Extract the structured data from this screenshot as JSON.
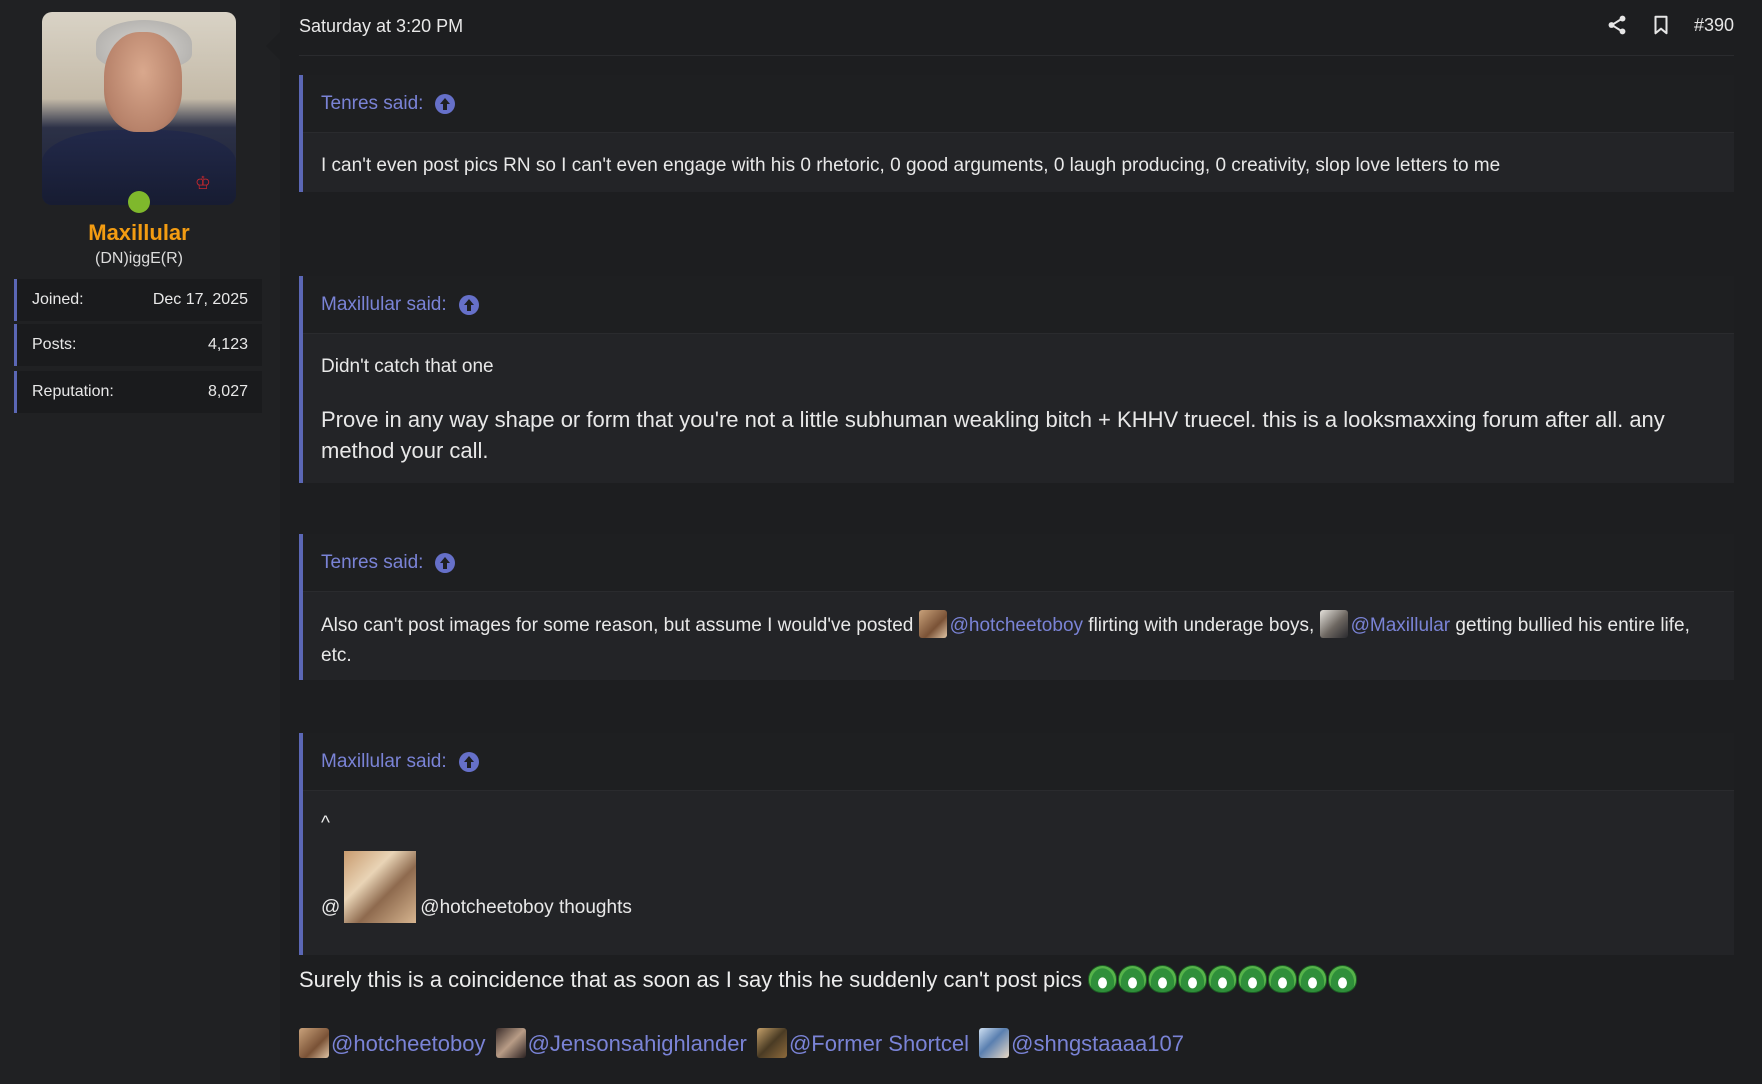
{
  "user": {
    "name": "Maxillular",
    "title": "(DN)iggE(R)",
    "stats": [
      {
        "label": "Joined:",
        "value": "Dec 17, 2025"
      },
      {
        "label": "Posts:",
        "value": "4,123"
      },
      {
        "label": "Reputation:",
        "value": "8,027"
      }
    ],
    "online": true
  },
  "post": {
    "date": "Saturday at 3:20 PM",
    "number": "#390",
    "icons": {
      "share": "share-icon",
      "bookmark": "bookmark-icon"
    }
  },
  "quotes": [
    {
      "author": "Tenres said:",
      "text": "I can't even post pics RN so I can't even engage with his 0 rhetoric, 0 good arguments, 0 laugh producing, 0 creativity, slop love letters to me"
    },
    {
      "author": "Maxillular said:",
      "line1": "Didn't catch that one",
      "line2": "Prove in any way shape or form that you're not a little subhuman weakling bitch + KHHV truecel. this is a looksmaxxing forum after all. any method your call."
    },
    {
      "author": "Tenres said:",
      "text_a": "Also can't post images for some reason, but assume I would've posted ",
      "mention_a": "@hotcheetoboy",
      "text_b": " flirting with underage boys, ",
      "mention_b": "@Maxillular",
      "text_c": " getting bullied his entire life, etc."
    },
    {
      "author": "Maxillular said:",
      "caret": "^",
      "at": "@",
      "trailing": "@hotcheetoboy thoughts"
    }
  ],
  "body": {
    "text": "Surely this is a coincidence that as soon as I say this he suddenly can't post pics",
    "emoji_count": 9,
    "mentions": [
      "@hotcheetoboy",
      "@Jensonsahighlander",
      "@Former Shortcel",
      "@shngstaaaa107"
    ]
  },
  "colors": {
    "accent": "#5b67b5",
    "link": "#7a83d6",
    "username": "#f39c12",
    "online": "#7fb82c"
  }
}
